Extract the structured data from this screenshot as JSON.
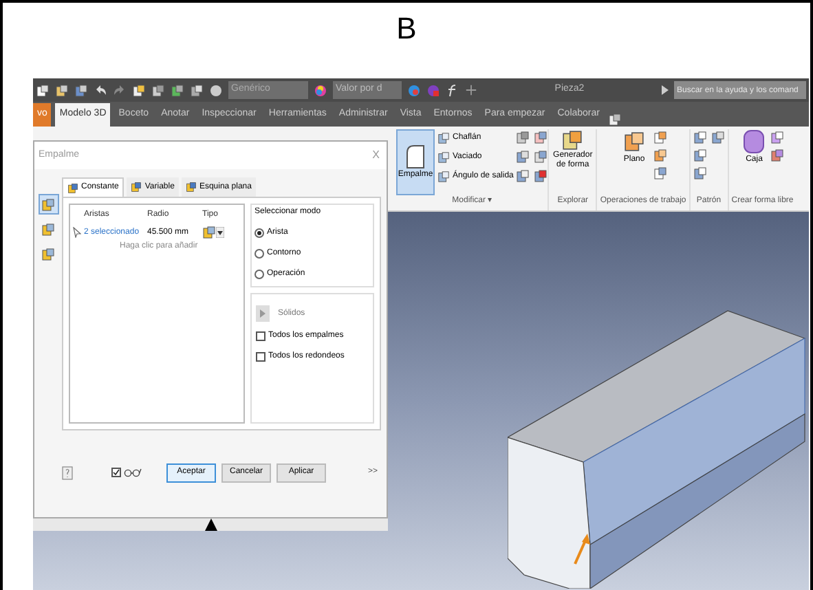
{
  "figure_label": "B",
  "toolbar": {
    "material": "Genérico",
    "appearance": "Valor por d",
    "document_title": "Pieza2",
    "search": {
      "placeholder": "Buscar en la ayuda y los comand"
    }
  },
  "ribbon_tabs": [
    {
      "label": "vo",
      "kind": "file"
    },
    {
      "label": "Modelo 3D",
      "kind": "tab",
      "selected": true
    },
    {
      "label": "Boceto",
      "kind": "tab",
      "selected": false
    },
    {
      "label": "Anotar",
      "kind": "tab",
      "selected": false
    },
    {
      "label": "Inspeccionar",
      "kind": "tab",
      "selected": false
    },
    {
      "label": "Herramientas",
      "kind": "tab",
      "selected": false
    },
    {
      "label": "Administrar",
      "kind": "tab",
      "selected": false
    },
    {
      "label": "Vista",
      "kind": "tab",
      "selected": false
    },
    {
      "label": "Entornos",
      "kind": "tab",
      "selected": false
    },
    {
      "label": "Para empezar",
      "kind": "tab",
      "selected": false
    },
    {
      "label": "Colaborar",
      "kind": "tab",
      "selected": false
    }
  ],
  "ribbon": {
    "fillet": {
      "label": "Empalme",
      "selected": true
    },
    "modify_tools": [
      "Chaflán",
      "Vaciado",
      "Ángulo de salida"
    ],
    "shape_generator": "Generador de forma",
    "plane": "Plano",
    "box": "Caja",
    "groups": [
      "Modificar ▾",
      "Explorar",
      "Operaciones de trabajo",
      "Patrón",
      "Crear forma libre"
    ]
  },
  "dialog": {
    "title": "Empalme",
    "close": "X",
    "side_modes": [
      {
        "selected": true
      },
      {
        "selected": false
      },
      {
        "selected": false
      }
    ],
    "tabs": [
      {
        "label": "Constante",
        "selected": true
      },
      {
        "label": "Variable",
        "selected": false
      },
      {
        "label": "Esquina plana",
        "selected": false
      }
    ],
    "columns": [
      "Aristas",
      "Radio",
      "Tipo"
    ],
    "rows": [
      {
        "edges": "2 seleccionado",
        "radius": "45.500 mm"
      }
    ],
    "add_hint": "Haga clic para añadir",
    "mode_group": {
      "title": "Seleccionar modo",
      "options": [
        {
          "label": "Arista",
          "selected": true
        },
        {
          "label": "Contorno",
          "selected": false
        },
        {
          "label": "Operación",
          "selected": false
        }
      ]
    },
    "solids_button": "Sólidos",
    "checkboxes": [
      {
        "label": "Todos los empalmes",
        "checked": false
      },
      {
        "label": "Todos los redondeos",
        "checked": false
      }
    ],
    "preview": {
      "checked": true
    },
    "buttons": [
      {
        "label": "Aceptar",
        "kind": "default"
      },
      {
        "label": "Cancelar",
        "kind": "normal"
      },
      {
        "label": "Aplicar",
        "kind": "normal"
      }
    ],
    "more": ">>"
  }
}
